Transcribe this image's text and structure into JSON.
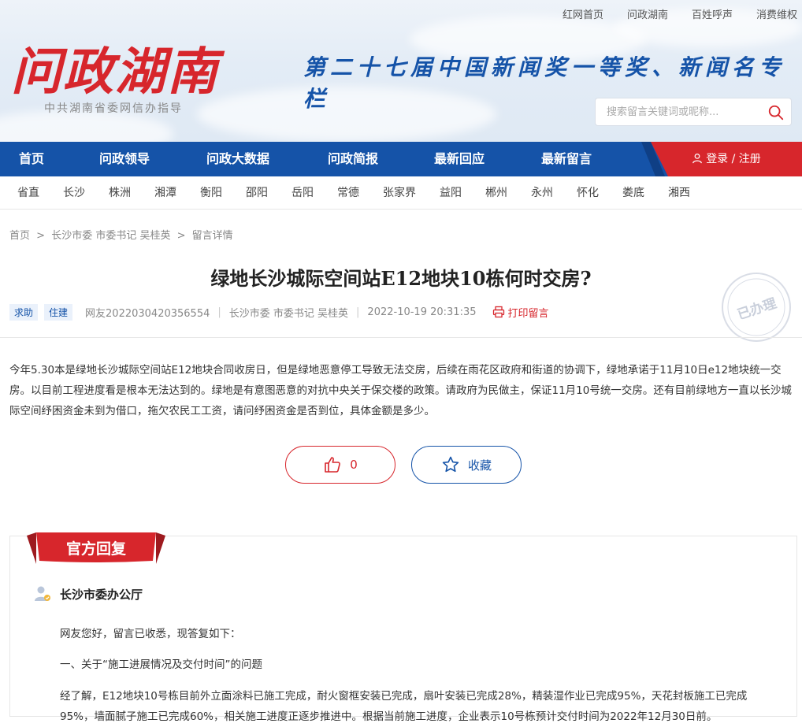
{
  "top_links": [
    "红网首页",
    "问政湖南",
    "百姓呼声",
    "消费维权"
  ],
  "brand": {
    "logo_text": "问政湖南",
    "subtitle": "中共湖南省委网信办指导",
    "slogan": "第二十七届中国新闻奖一等奖、新闻名专栏"
  },
  "search": {
    "placeholder": "搜索留言关键词或昵称..."
  },
  "nav": [
    "首页",
    "问政领导",
    "问政大数据",
    "问政简报",
    "最新回应",
    "最新留言"
  ],
  "login": {
    "label": "登录 / 注册"
  },
  "cities": [
    "省直",
    "长沙",
    "株洲",
    "湘潭",
    "衡阳",
    "邵阳",
    "岳阳",
    "常德",
    "张家界",
    "益阳",
    "郴州",
    "永州",
    "怀化",
    "娄底",
    "湘西"
  ],
  "breadcrumb": {
    "home": "首页",
    "leader": "长沙市委 市委书记 吴桂英",
    "current": "留言详情",
    "sep": ">"
  },
  "post": {
    "title": "绿地长沙城际空间站E12地块10栋何时交房?",
    "tags": [
      "求助",
      "住建"
    ],
    "user": "网友2022030420356554",
    "target": "长沙市委 市委书记 吴桂英",
    "time": "2022-10-19 20:31:35",
    "print_label": "打印留言",
    "stamp": "已办理",
    "body": "今年5.30本是绿地长沙城际空间站E12地块合同收房日，但是绿地恶意停工导致无法交房，后续在雨花区政府和街道的协调下，绿地承诺于11月10日e12地块统一交房。以目前工程进度看是根本无法达到的。绿地是有意图恶意的对抗中央关于保交楼的政策。请政府为民做主，保证11月10号统一交房。还有目前绿地方一直以长沙城际空间纾困资金未到为借口，拖欠农民工工资，请问纾困资金是否到位，具体金额是多少。",
    "likes": "0",
    "favorite_label": "收藏"
  },
  "reply": {
    "header": "官方回复",
    "department": "长沙市委办公厅",
    "greeting": "网友您好，留言已收悉，现答复如下：",
    "section1": "一、关于“施工进展情况及交付时间”的问题",
    "para1": "经了解，E12地块10号栋目前外立面涂料已施工完成，耐火窗框安装已完成，扇叶安装已完成28%，精装湿作业已完成95%，天花封板施工已完成95%，墙面腻子施工已完成60%，相关施工进度正逐步推进中。根据当前施工进度，企业表示10号栋预计交付时间为2022年12月30日前。"
  },
  "colors": {
    "brand_red": "#d7262c",
    "brand_blue": "#1553a8"
  }
}
